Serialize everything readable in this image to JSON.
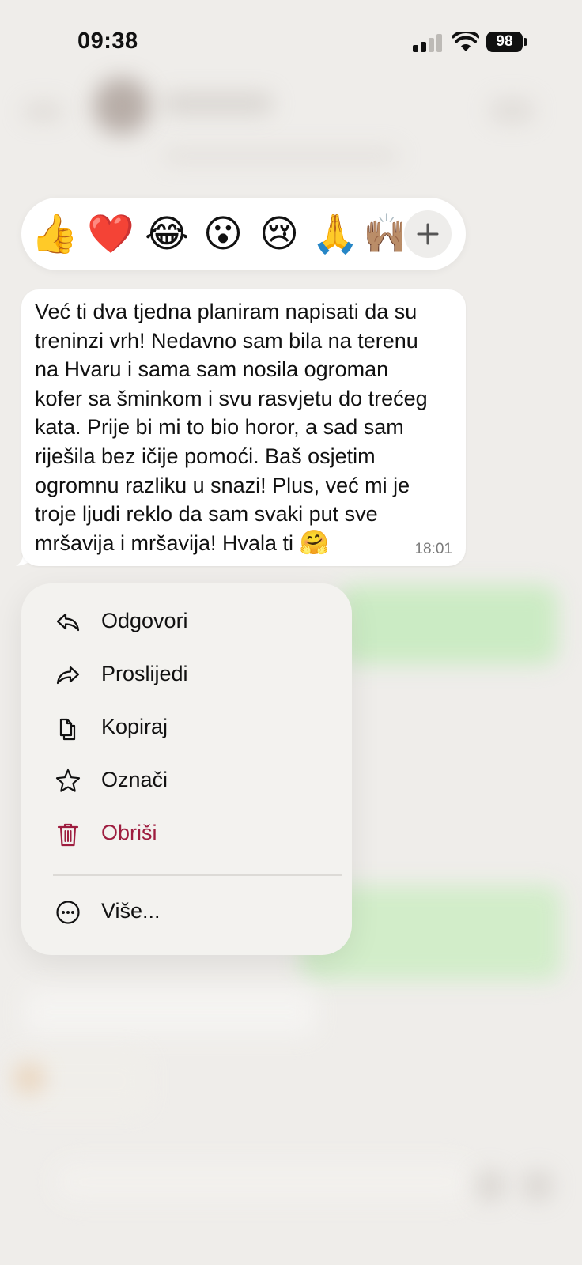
{
  "status_bar": {
    "time": "09:38",
    "battery": "98"
  },
  "reactions": {
    "items": [
      {
        "emoji": "👍",
        "name": "thumbs-up"
      },
      {
        "emoji": "❤️",
        "name": "red-heart"
      },
      {
        "emoji": "😂",
        "name": "tears-of-joy"
      },
      {
        "emoji": "😮",
        "name": "surprised-face"
      },
      {
        "emoji": "😢",
        "name": "crying-face"
      },
      {
        "emoji": "🙏",
        "name": "folded-hands"
      },
      {
        "emoji": "🙌🏽",
        "name": "raised-hands"
      }
    ],
    "more_icon": "plus-icon"
  },
  "message": {
    "text": "Već ti dva tjedna planiram napisati da su\ntreninzi vrh! Nedavno sam bila na terenu\nna Hvaru i sama sam nosila ogroman\nkofer sa šminkom i svu rasvjetu do trećeg\nkata. Prije bi mi to bio horor, a sad sam\nriješila bez ičije pomoći. Baš osjetim\nogromnu razliku u snazi! Plus, već mi je\ntroje ljudi reklo da sam svaki put sve\nmršavija i mršavija! Hvala ti ",
    "emoji": "🤗",
    "time": "18:01"
  },
  "menu": {
    "items": [
      {
        "label": "Odgovori",
        "icon": "reply-icon"
      },
      {
        "label": "Proslijedi",
        "icon": "forward-icon"
      },
      {
        "label": "Kopiraj",
        "icon": "copy-icon"
      },
      {
        "label": "Označi",
        "icon": "star-icon"
      },
      {
        "label": "Obriši",
        "icon": "trash-icon",
        "danger": true
      }
    ],
    "more": {
      "label": "Više...",
      "icon": "more-icon"
    }
  },
  "colors": {
    "background": "#efedea",
    "danger": "#9e1d3f",
    "bubble": "#ffffff"
  }
}
